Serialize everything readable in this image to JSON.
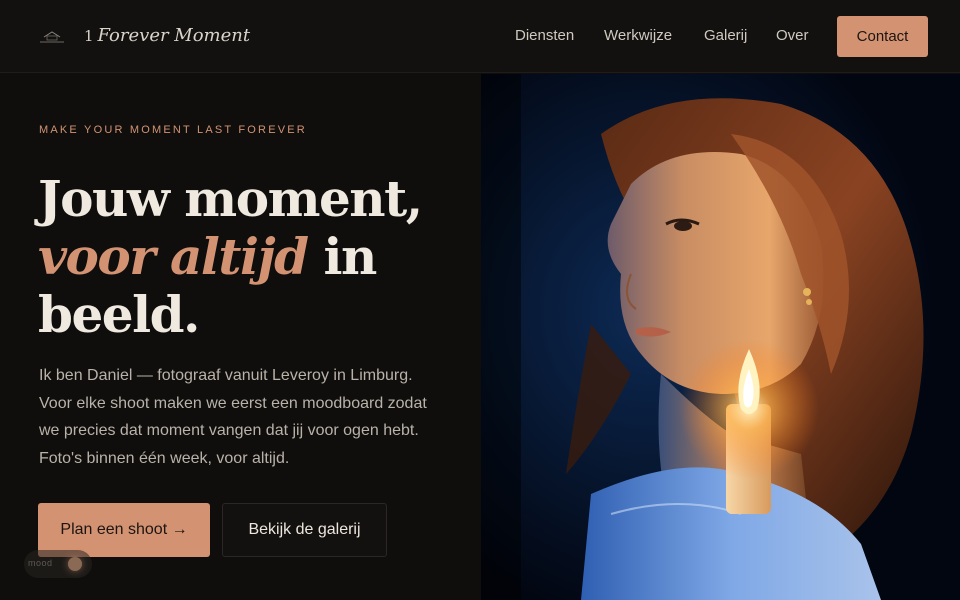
{
  "brand": {
    "number": "1",
    "name": "Forever Moment"
  },
  "nav": {
    "links": [
      "Diensten",
      "Werkwijze",
      "Galerij",
      "Over"
    ],
    "contact_label": "Contact"
  },
  "hero": {
    "eyebrow": "MAKE YOUR MOMENT LAST FOREVER",
    "headline": {
      "line1": "Jouw moment,",
      "accent": "voor altijd",
      "after_accent": " in",
      "line3": "beeld."
    },
    "intro": "Ik ben Daniel — fotograaf vanuit Leveroy in Limburg. Voor elke shoot maken we eerst een moodboard zodat we precies dat moment vangen dat jij voor ogen hebt. Foto's binnen één week, voor altijd.",
    "primary_cta": "Plan een shoot →",
    "secondary_cta": "Bekijk de galerij"
  },
  "mood_toggle": {
    "label": "mood"
  },
  "colors": {
    "accent": "#d39373",
    "background": "#0f0e0d",
    "nav_bg": "#121110"
  }
}
